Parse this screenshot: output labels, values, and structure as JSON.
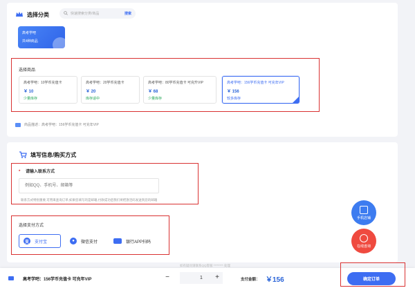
{
  "section_category": {
    "title": "选择分类",
    "search_placeholder": "快速搜索分类/商品",
    "search_button": "搜索",
    "category": {
      "name": "高考学吧",
      "count": "共4种商品"
    }
  },
  "section_products": {
    "title": "选择商品",
    "items": [
      {
        "name": "高考学吧：10学币充值卡",
        "price": "￥ 10",
        "stock": "少量库存",
        "stock_color": "#27a85a",
        "selected": false
      },
      {
        "name": "高考学吧：20学币充值卡",
        "price": "￥ 20",
        "stock": "库存适中",
        "stock_color": "#27a85a",
        "selected": false
      },
      {
        "name": "高考学吧：80学币充值卡 可充升VIP",
        "price": "￥ 68",
        "stock": "少量库存",
        "stock_color": "#27a85a",
        "selected": false
      },
      {
        "name": "高考学吧：156学币充值卡 可充年VIP",
        "price": "￥ 156",
        "stock": "较多库存",
        "stock_color": "#3d6df2",
        "selected": true
      }
    ],
    "description": "商品描述：高考学吧：156学币充值卡 可充年VIP"
  },
  "section_contact": {
    "title": "填写信息/购买方式",
    "required_mark": "*",
    "label": "请输入联系方式",
    "placeholder": "例如QQ、手机号、邮箱等",
    "hint": "联系方式特别重要,可用来查询订单,如果您填写的是邮箱,付款成功后我们将把激活码发送到您的邮箱"
  },
  "section_payment": {
    "label": "选择支付方式",
    "options": [
      {
        "label": "支付宝",
        "icon": "alipay-icon",
        "color": "#3d6df2"
      },
      {
        "label": "微信支付",
        "icon": "wechat-pay-icon",
        "color": "#3d6df2"
      },
      {
        "label": "银行APP扫码",
        "icon": "bank-card-icon",
        "color": "#3d6df2"
      }
    ]
  },
  "floating": {
    "mobile_store": "手机店铺",
    "online_service": "在线咨询"
  },
  "footnote": "如有疑问请联系QQ客服 ******** 处理",
  "bottom_bar": {
    "product_name": "高考学吧：156学币充值卡 可充年VIP",
    "minus": "−",
    "quantity": "1",
    "plus": "+",
    "total_label": "支付金额：",
    "total_value": "￥156",
    "order_button": "确定订单"
  },
  "colors": {
    "accent": "#3d6df2",
    "highlight_box": "#d93030",
    "service": "#ef4a3f"
  }
}
